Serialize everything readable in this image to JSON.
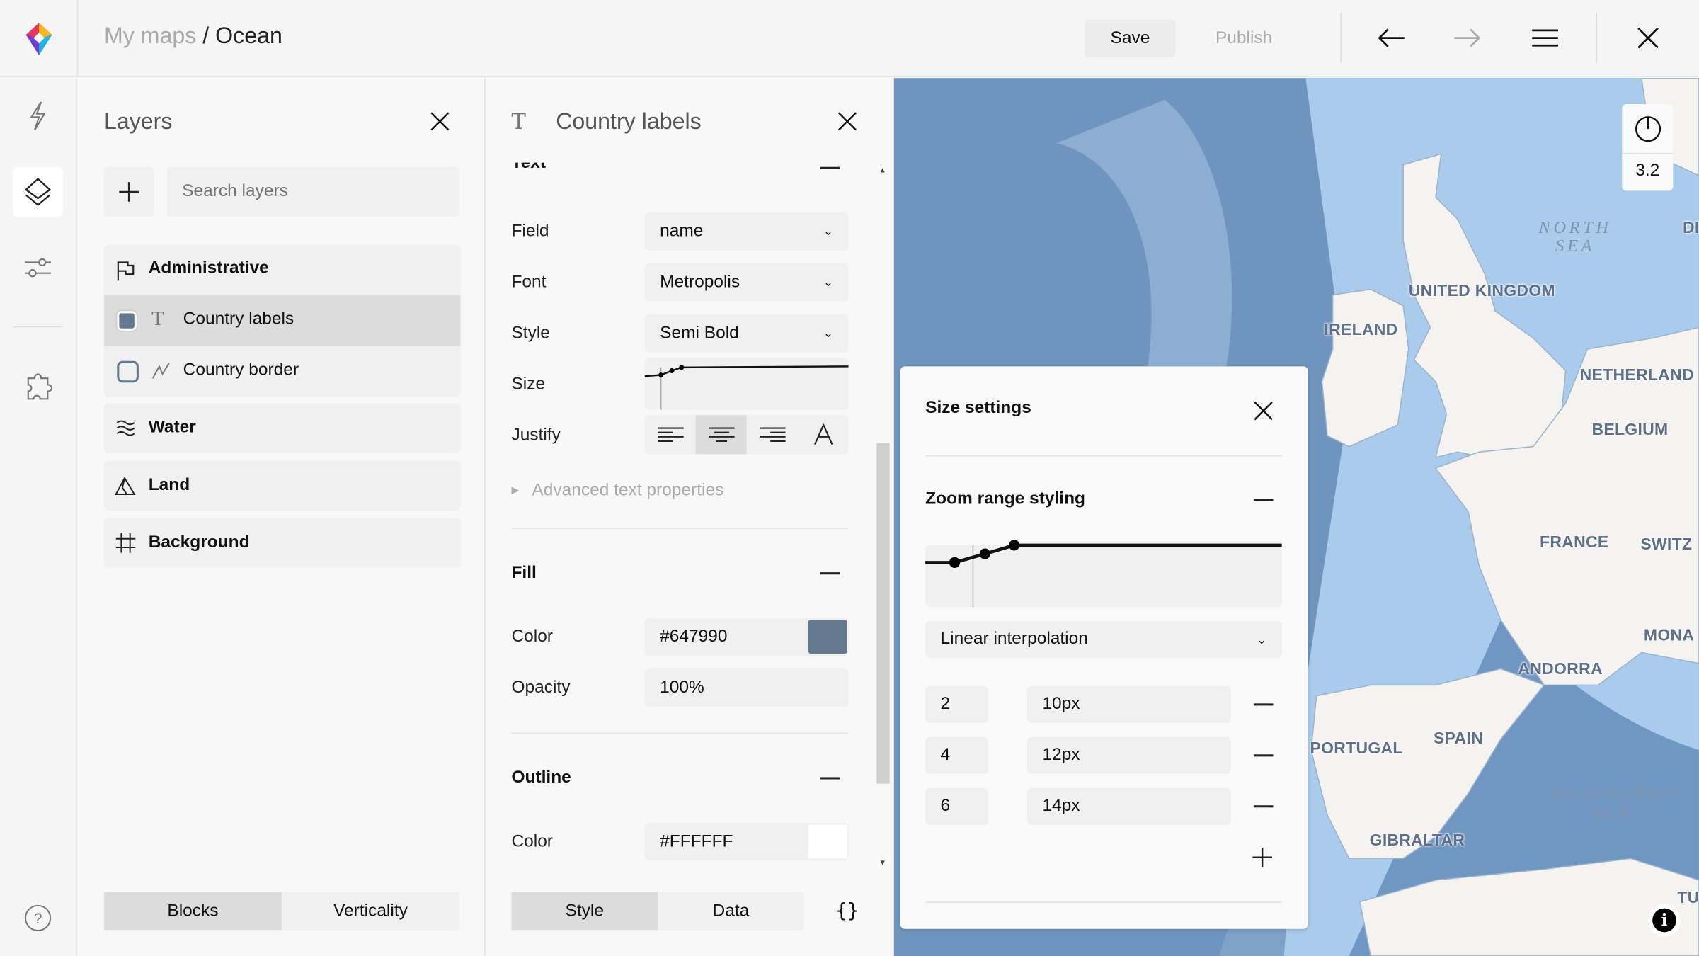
{
  "header": {
    "breadcrumb_parent": "My maps",
    "separator": " / ",
    "map_name": "Ocean",
    "save_label": "Save",
    "publish_label": "Publish"
  },
  "layers_panel": {
    "title": "Layers",
    "search_placeholder": "Search layers",
    "groups": [
      {
        "label": "Administrative",
        "icon": "flag-icon"
      },
      {
        "label": "Water",
        "icon": "waves-icon"
      },
      {
        "label": "Land",
        "icon": "mountain-icon"
      },
      {
        "label": "Background",
        "icon": "grid-icon"
      }
    ],
    "admin_layers": [
      {
        "label": "Country labels",
        "color": "#647990"
      },
      {
        "label": "Country border",
        "color": "#647990"
      }
    ],
    "tabs": [
      "Blocks",
      "Verticality"
    ]
  },
  "style_panel": {
    "title": "Country labels",
    "section_text": "Text",
    "field_label": "Field",
    "field_value": "name",
    "font_label": "Font",
    "font_value": "Metropolis",
    "style_label": "Style",
    "style_value": "Semi Bold",
    "size_label": "Size",
    "justify_label": "Justify",
    "advanced": "Advanced text properties",
    "fill": {
      "title": "Fill",
      "color_label": "Color",
      "color_value": "#647990",
      "opacity_label": "Opacity",
      "opacity_value": "100%"
    },
    "outline": {
      "title": "Outline",
      "color_label": "Color",
      "color_value": "#FFFFFF"
    },
    "tabs": [
      "Style",
      "Data"
    ],
    "code_label": "{}"
  },
  "size_settings": {
    "title": "Size settings",
    "section": "Zoom range styling",
    "interpolation": "Linear interpolation",
    "stops": [
      {
        "zoom": "2",
        "size": "10px"
      },
      {
        "zoom": "4",
        "size": "12px"
      },
      {
        "zoom": "6",
        "size": "14px"
      }
    ]
  },
  "map": {
    "zoom": "3.2",
    "labels": {
      "uk": "UNITED KINGDOM",
      "ireland": "IRELAND",
      "netherlands": "NETHERLAND",
      "belgium": "BELGIUM",
      "france": "FRANCE",
      "switz": "SWITZ",
      "monaco": "MONA",
      "andorra": "ANDORRA",
      "spain": "SPAIN",
      "portugal": "PORTUGAL",
      "gibraltar": "GIBRALTAR",
      "de": "DI",
      "tu": "TU"
    },
    "seas": {
      "north1": "NORTH",
      "north2": "SEA",
      "med1": "MEDITERRA",
      "med2": "SEA"
    }
  },
  "colors": {
    "accent_fill": "#647990"
  }
}
